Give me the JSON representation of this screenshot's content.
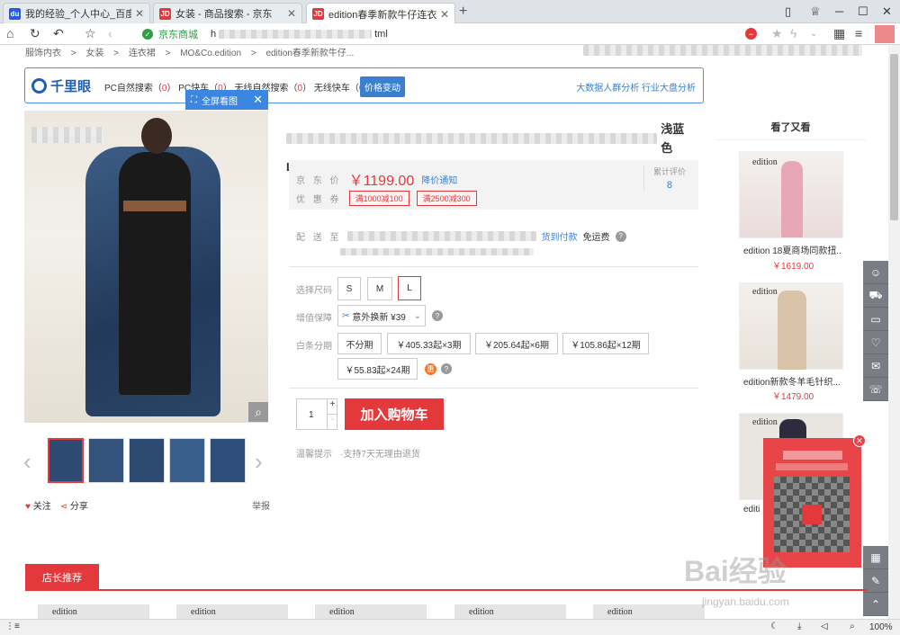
{
  "browser": {
    "tabs": [
      {
        "title": "我的经验_个人中心_百度经验",
        "fav": "du",
        "color": "#2a5bd7"
      },
      {
        "title": "女装 - 商品搜索 - 京东",
        "fav": "JD",
        "color": "#e4393c"
      },
      {
        "title": "edition春季新款牛仔连衣裙E/",
        "fav": "JD",
        "color": "#e4393c"
      }
    ],
    "site_name": "京东商城",
    "url_prefix": "h",
    "url_suffix": "tml",
    "zoom": "100%"
  },
  "breadcrumb": [
    "服饰内衣",
    ">",
    "女装",
    ">",
    "连衣裙",
    ">",
    "MO&Co.edition",
    ">",
    "edition春季新款牛仔..."
  ],
  "qianliyan": {
    "logo": "千里眼",
    "stats": [
      {
        "label": "PC自然搜索（",
        "value": "0",
        "end": "）"
      },
      {
        "label": "PC快车（",
        "value": "0",
        "end": "）"
      },
      {
        "label": "无线自然搜索（",
        "value": "0",
        "end": "）"
      },
      {
        "label": "无线快车（",
        "value": "0",
        "end": "）"
      }
    ],
    "button": "价格变动",
    "link1": "大数据人群分析",
    "link2": "行业大盘分析"
  },
  "fullscreen": {
    "label": "全屏看图",
    "close": "✕"
  },
  "product": {
    "title_visible": "浅蓝色",
    "title_line2": "L",
    "price_label": "京 东 价",
    "price": "￥1199.00",
    "price_notify": "降价通知",
    "promo_label": "优 惠 券",
    "coupons": [
      "满1000减100",
      "满2500减300"
    ],
    "reviews_label": "累计评价",
    "reviews_count": "8",
    "delivery_label": "配 送 至",
    "pay_on_delivery": "货到付款",
    "free_shipping": "免运费",
    "size_label": "选择尺码",
    "sizes": [
      "S",
      "M",
      "L"
    ],
    "selected_size": "L",
    "warranty_label": "增值保障",
    "warranty_option": "意外换新 ¥39",
    "installment_label": "白条分期",
    "installments": [
      "不分期",
      "￥405.33起×3期",
      "￥205.64起×6期",
      "￥105.86起×12期",
      "￥55.83起×24期"
    ],
    "quantity": "1",
    "add_to_cart": "加入购物车",
    "tips_label": "温馨提示",
    "tips_text": "·支持7天无理由退货"
  },
  "gallery": {
    "follow": "关注",
    "share": "分享",
    "report": "举报"
  },
  "see_also": {
    "title": "看了又看",
    "items": [
      {
        "name": "edition 18夏商场同款扭...",
        "price": "￥1619.00",
        "brand": "edition"
      },
      {
        "name": "edition新款冬羊毛针织...",
        "price": "￥1479.00",
        "brand": "edition"
      },
      {
        "name": "editi",
        "brand": "edition"
      }
    ]
  },
  "shop_rec": {
    "title": "店长推荐",
    "items": [
      "edition",
      "edition",
      "edition",
      "edition",
      "edition"
    ]
  },
  "watermark": {
    "text": "Bai经验",
    "url": "jingyan.baidu.com"
  }
}
